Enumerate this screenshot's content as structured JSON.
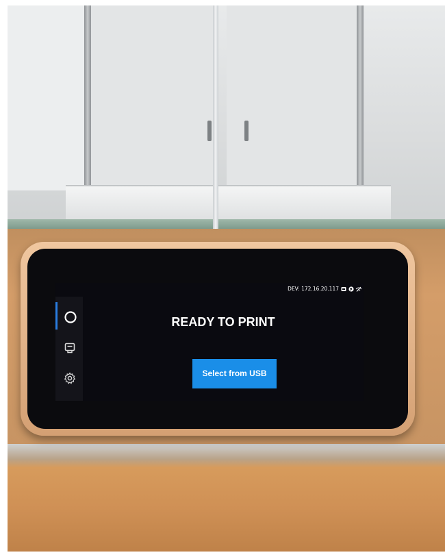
{
  "status_bar": {
    "network_text": "DEV: 172.16.20.117",
    "icons": [
      "usb-icon",
      "bluetooth-icon",
      "wifi-off-icon"
    ]
  },
  "sidebar": {
    "items": [
      {
        "name": "home",
        "icon": "circle-icon",
        "active": true
      },
      {
        "name": "queue",
        "icon": "tray-icon",
        "active": false
      },
      {
        "name": "settings",
        "icon": "gear-icon",
        "active": false
      }
    ]
  },
  "main": {
    "title": "READY TO PRINT",
    "usb_button_label": "Select from USB"
  },
  "colors": {
    "accent": "#1a8ee8",
    "indicator": "#2a7de1",
    "screen_bg": "#0a0a10"
  }
}
